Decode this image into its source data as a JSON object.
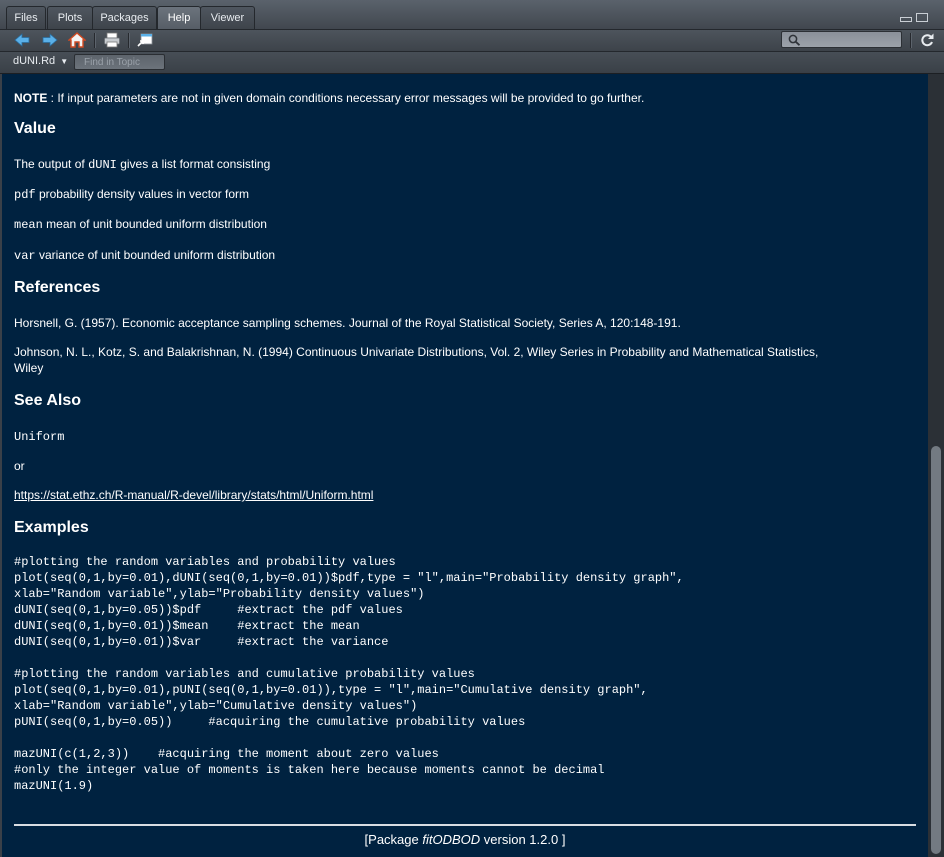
{
  "tabs": [
    {
      "label": "Files",
      "active": false
    },
    {
      "label": "Plots",
      "active": false
    },
    {
      "label": "Packages",
      "active": false
    },
    {
      "label": "Help",
      "active": true
    },
    {
      "label": "Viewer",
      "active": false
    }
  ],
  "toolbar": {
    "icons": [
      "back-arrow-icon",
      "forward-arrow-icon",
      "home-icon",
      "print-icon",
      "show-in-new-window-icon",
      "search-icon",
      "refresh-icon"
    ],
    "search_value": ""
  },
  "topic_bar": {
    "topic": "dUNI.Rd",
    "find_placeholder": "Find in Topic"
  },
  "doc": {
    "note_label": "NOTE",
    "note_text": " : If input parameters are not in given domain conditions necessary error messages will be provided to go further.",
    "value_heading": "Value",
    "value_intro_pre": "The output of ",
    "value_intro_code": "dUNI",
    "value_intro_post": " gives a list format consisting",
    "value_items": [
      {
        "code": "pdf",
        "text": " probability density values in vector form"
      },
      {
        "code": "mean",
        "text": " mean of unit bounded uniform distribution"
      },
      {
        "code": "var",
        "text": " variance of unit bounded uniform distribution"
      }
    ],
    "references_heading": "References",
    "ref1": "Horsnell, G. (1957). Economic acceptance sampling schemes. Journal of the Royal Statistical Society, Series A, 120:148-191.",
    "ref2_line1": "Johnson, N. L., Kotz, S. and Balakrishnan, N. (1994) Continuous Univariate Distributions, Vol. 2, Wiley Series in Probability and Mathematical Statistics,",
    "ref2_line2": "Wiley",
    "see_also_heading": "See Also",
    "see_also_code": "Uniform",
    "see_also_or": "or",
    "see_also_link": "https://stat.ethz.ch/R-manual/R-devel/library/stats/html/Uniform.html",
    "examples_heading": "Examples",
    "examples_code": "#plotting the random variables and probability values\nplot(seq(0,1,by=0.01),dUNI(seq(0,1,by=0.01))$pdf,type = \"l\",main=\"Probability density graph\",\nxlab=\"Random variable\",ylab=\"Probability density values\")\ndUNI(seq(0,1,by=0.05))$pdf     #extract the pdf values\ndUNI(seq(0,1,by=0.01))$mean    #extract the mean\ndUNI(seq(0,1,by=0.01))$var     #extract the variance\n\n#plotting the random variables and cumulative probability values\nplot(seq(0,1,by=0.01),pUNI(seq(0,1,by=0.01)),type = \"l\",main=\"Cumulative density graph\",\nxlab=\"Random variable\",ylab=\"Cumulative density values\")\npUNI(seq(0,1,by=0.05))     #acquiring the cumulative probability values\n\nmazUNI(c(1,2,3))    #acquiring the moment about zero values\n#only the integer value of moments is taken here because moments cannot be decimal\nmazUNI(1.9)",
    "footer_pre": "[Package ",
    "footer_pkg": "fitODBOD",
    "footer_post": " version 1.2.0 ]"
  }
}
